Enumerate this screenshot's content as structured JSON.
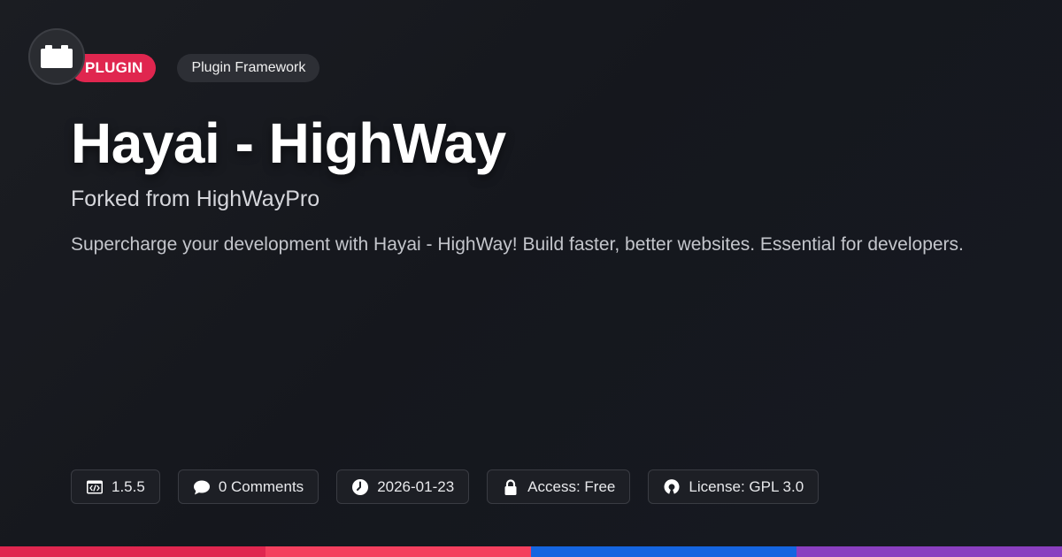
{
  "badge": {
    "label": "PLUGIN",
    "color": "#e0264f"
  },
  "category": {
    "label": "Plugin Framework"
  },
  "logo": {
    "icon": "plugin-brick-icon"
  },
  "title": "Hayai - HighWay",
  "subtitle": "Forked from HighWayPro",
  "description": "Supercharge your development with Hayai - HighWay! Build faster, better websites. Essential for developers.",
  "meta": {
    "version": {
      "icon": "code-window-icon",
      "text": "1.5.5"
    },
    "comments": {
      "icon": "comment-icon",
      "text": "0 Comments"
    },
    "date": {
      "icon": "clock-icon",
      "text": "2026-01-23"
    },
    "access": {
      "icon": "lock-icon",
      "text": "Access: Free"
    },
    "license": {
      "icon": "open-source-icon",
      "text": "License: GPL 3.0"
    }
  },
  "bottom_bar_colors": [
    "#e0264f",
    "#f43f5e",
    "#1565e0",
    "#8a3fc0"
  ]
}
